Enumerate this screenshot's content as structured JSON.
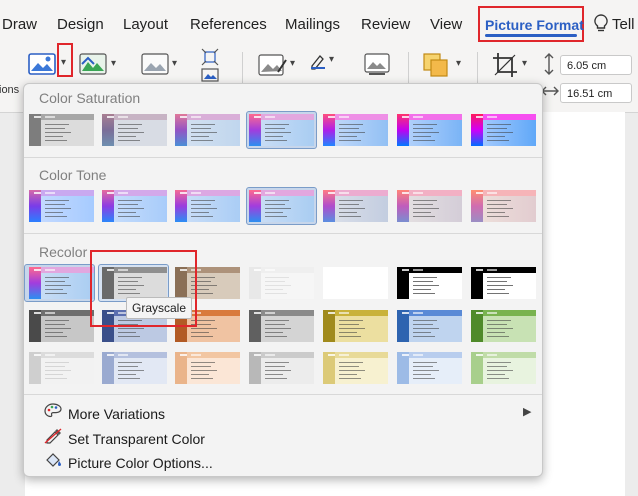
{
  "ribbon_tabs": [
    "Draw",
    "Design",
    "Layout",
    "References",
    "Mailings",
    "Review",
    "View"
  ],
  "active_tab": "Picture Format",
  "tell_me": "Tell",
  "ribbon_left_cut_label": "ions",
  "height_value": "6.05 cm",
  "width_value": "16.51 cm",
  "sections": {
    "saturation": "Color Saturation",
    "tone": "Color Tone",
    "recolor": "Recolor"
  },
  "tooltip": "Grayscale",
  "menu_items": {
    "more_variations": "More Variations",
    "set_transparent": "Set Transparent Color",
    "picture_color_options": "Picture Color Options..."
  },
  "accent_color": "#2b5fc4",
  "highlight_color": "#e0262b",
  "icons": {
    "tell_me": "lightbulb-icon",
    "more_variations": "palette-icon",
    "set_transparent": "eyedropper-icon",
    "picture_color_options": "paint-bucket-icon"
  }
}
